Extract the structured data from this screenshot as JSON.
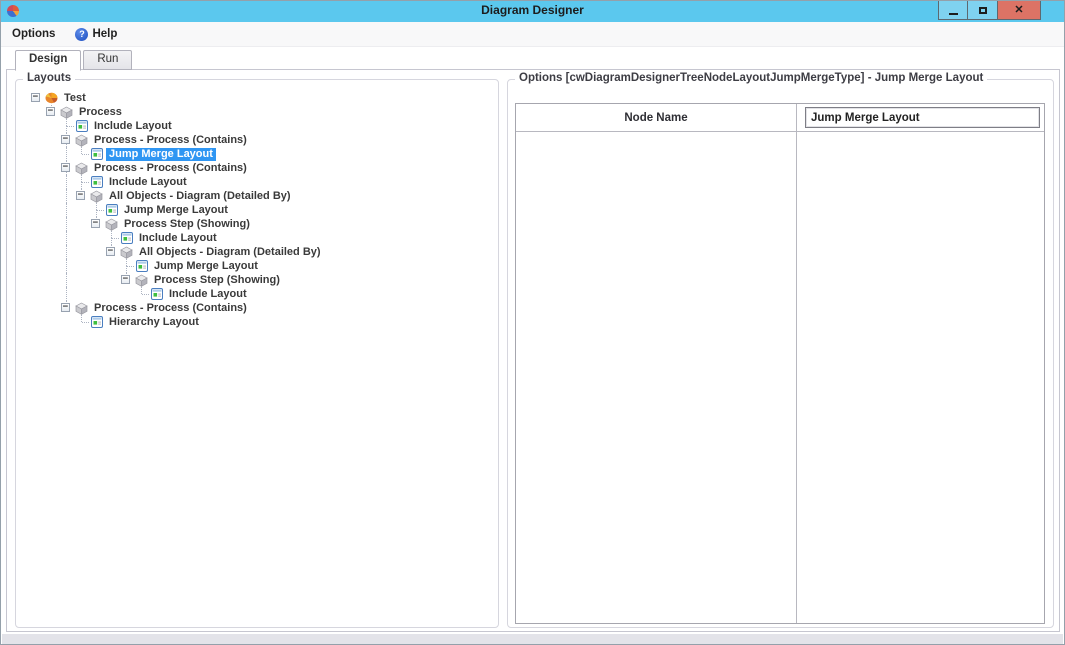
{
  "window": {
    "title": "Diagram Designer",
    "buttons": {
      "minimize": "minimize",
      "maximize": "maximize",
      "close": "close",
      "close_glyph": "✕"
    }
  },
  "menu": {
    "options_label": "Options",
    "help_label": "Help",
    "help_icon_glyph": "?"
  },
  "tabs": {
    "design_label": "Design",
    "run_label": "Run",
    "active": "Design"
  },
  "layouts": {
    "title": "Layouts",
    "tree": [
      {
        "label": "Test",
        "depth": 0,
        "icon": "model",
        "expandable": true,
        "selected": false
      },
      {
        "label": "Process",
        "depth": 1,
        "icon": "cube",
        "expandable": true,
        "selected": false
      },
      {
        "label": "Include Layout",
        "depth": 2,
        "icon": "layout",
        "expandable": false,
        "selected": false
      },
      {
        "label": "Process - Process (Contains)",
        "depth": 2,
        "icon": "cube",
        "expandable": true,
        "selected": false
      },
      {
        "label": "Jump Merge Layout",
        "depth": 3,
        "icon": "layout",
        "expandable": false,
        "selected": true
      },
      {
        "label": "Process - Process (Contains)",
        "depth": 2,
        "icon": "cube",
        "expandable": true,
        "selected": false
      },
      {
        "label": "Include Layout",
        "depth": 3,
        "icon": "layout",
        "expandable": false,
        "selected": false
      },
      {
        "label": "All Objects - Diagram (Detailed By)",
        "depth": 3,
        "icon": "cube",
        "expandable": true,
        "selected": false
      },
      {
        "label": "Jump Merge Layout",
        "depth": 4,
        "icon": "layout",
        "expandable": false,
        "selected": false
      },
      {
        "label": "Process Step (Showing)",
        "depth": 4,
        "icon": "cube",
        "expandable": true,
        "selected": false
      },
      {
        "label": "Include Layout",
        "depth": 5,
        "icon": "layout",
        "expandable": false,
        "selected": false
      },
      {
        "label": "All Objects - Diagram (Detailed By)",
        "depth": 5,
        "icon": "cube",
        "expandable": true,
        "selected": false
      },
      {
        "label": "Jump Merge Layout",
        "depth": 6,
        "icon": "layout",
        "expandable": false,
        "selected": false
      },
      {
        "label": "Process Step (Showing)",
        "depth": 6,
        "icon": "cube",
        "expandable": true,
        "selected": false
      },
      {
        "label": "Include Layout",
        "depth": 7,
        "icon": "layout",
        "expandable": false,
        "selected": false
      },
      {
        "label": "Process - Process (Contains)",
        "depth": 2,
        "icon": "cube",
        "expandable": true,
        "selected": false
      },
      {
        "label": "Hierarchy Layout",
        "depth": 3,
        "icon": "layout",
        "expandable": false,
        "selected": false
      }
    ]
  },
  "options": {
    "title": "Options [cwDiagramDesignerTreeNodeLayoutJumpMergeType] - Jump Merge Layout",
    "table": {
      "column_header": "Node Name",
      "value": "Jump Merge Layout"
    }
  },
  "colors": {
    "titlebar": "#5bc8ee",
    "close_button": "#dc7365",
    "selection": "#2f96f3",
    "help_icon": "#1e4fc0"
  }
}
